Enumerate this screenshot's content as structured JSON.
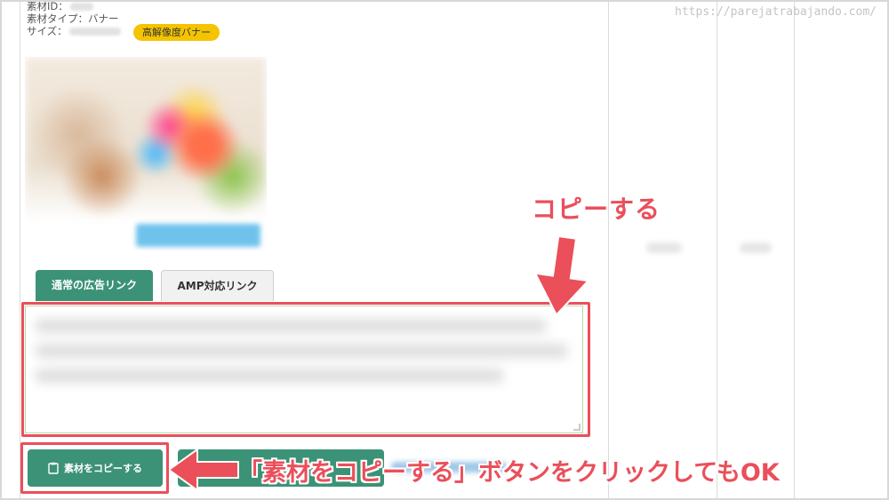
{
  "watermark": "https://parejatrabajando.com/",
  "material_info": {
    "id_label": "素材ID：",
    "type_label": "素材タイプ：バナー",
    "size_label": "サイズ：",
    "badge": "高解像度バナー"
  },
  "tabs": [
    {
      "label": "通常の広告リンク",
      "active": true
    },
    {
      "label": "AMP対応リンク",
      "active": false
    }
  ],
  "copy_button": {
    "label": "素材をコピーする"
  },
  "annotations": {
    "top": "コピーする",
    "bottom": "「素材をコピーする」ボタンをクリックしてもOK"
  },
  "colors": {
    "accent_green": "#3c9277",
    "highlight_red": "#ea4f5a",
    "badge_yellow": "#f5c400"
  },
  "icons": [
    "clipboard-icon",
    "arrow-down-icon",
    "arrow-left-icon"
  ]
}
